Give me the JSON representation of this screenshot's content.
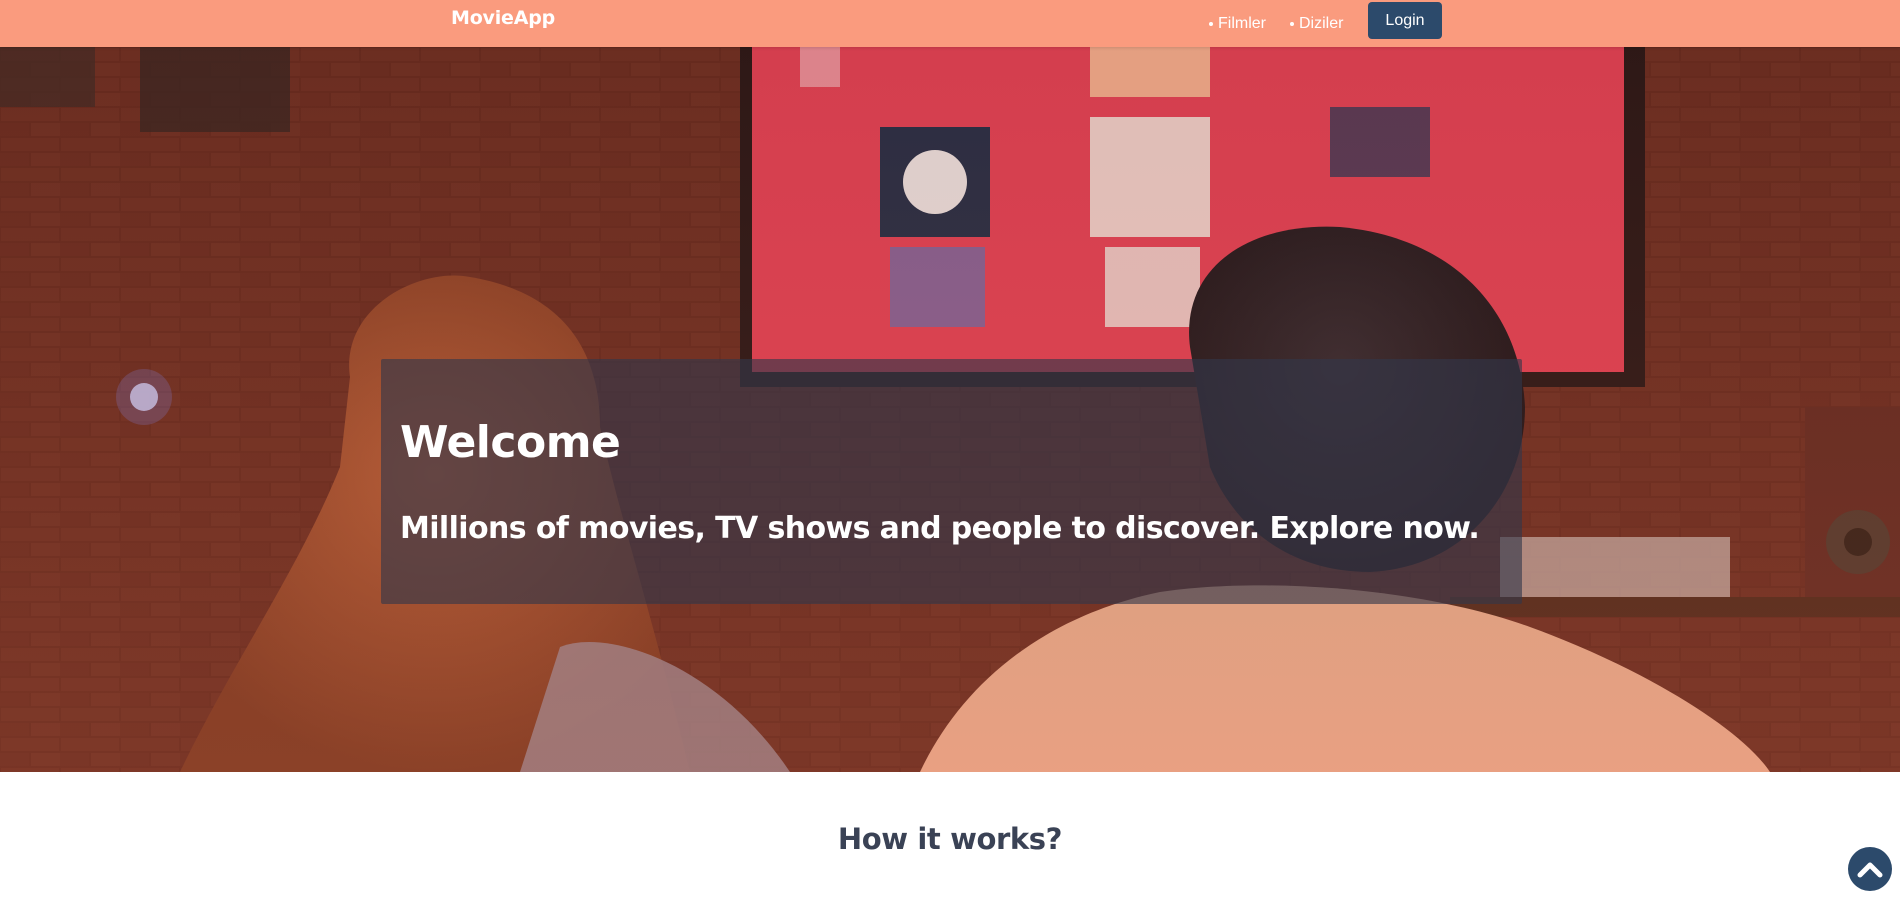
{
  "navbar": {
    "brand": "MovieApp",
    "links": [
      {
        "label": "Filmler"
      },
      {
        "label": "Diziler"
      }
    ],
    "login_label": "Login",
    "background_color": "#fa9b7e",
    "button_color": "#2c4a6b"
  },
  "hero": {
    "title": "Welcome",
    "subtitle": "Millions of movies, TV shows and people to discover. Explore now."
  },
  "how_it_works": {
    "title": "How it works?"
  },
  "scroll_top": {
    "icon": "chevron-up-icon"
  }
}
